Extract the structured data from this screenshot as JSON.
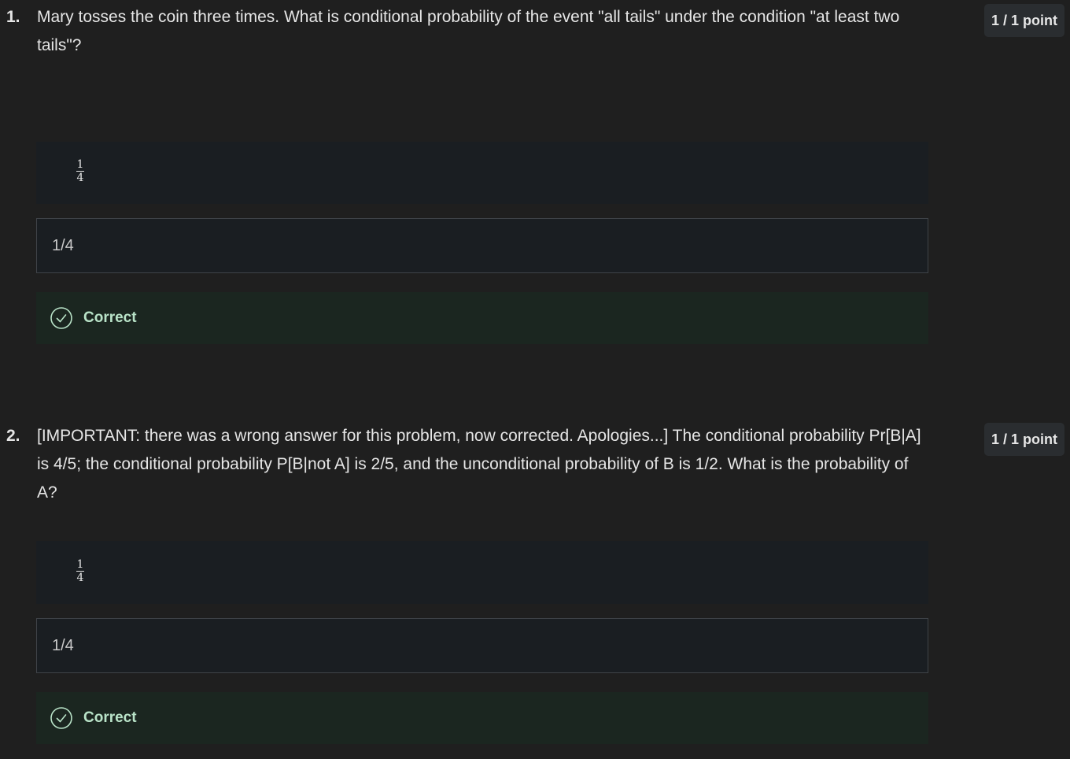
{
  "questions": [
    {
      "number": "1.",
      "text": "Mary tosses the coin three times. What is conditional probability of the event \"all tails\" under the condition \"at least two tails\"?",
      "points": "1 / 1 point",
      "math_answer": {
        "numerator": "1",
        "denominator": "4"
      },
      "input_value": "1/4",
      "feedback": "Correct",
      "feedback_icon": "check-circle-icon"
    },
    {
      "number": "2.",
      "text": "[IMPORTANT: there was a wrong answer for this problem, now corrected. Apologies...] The conditional probability Pr[B|A] is 4/5; the conditional probability P[B|not A] is 2/5, and the unconditional probability of B is 1/2. What is the probability of A?",
      "points": "1 / 1 point",
      "math_answer": {
        "numerator": "1",
        "denominator": "4"
      },
      "input_value": "1/4",
      "feedback": "Correct",
      "feedback_icon": "check-circle-icon"
    }
  ],
  "colors": {
    "background": "#1f1f1f",
    "correct_bg": "#1b2620",
    "correct_text": "#b9e3c8",
    "input_border": "#3f4348"
  }
}
